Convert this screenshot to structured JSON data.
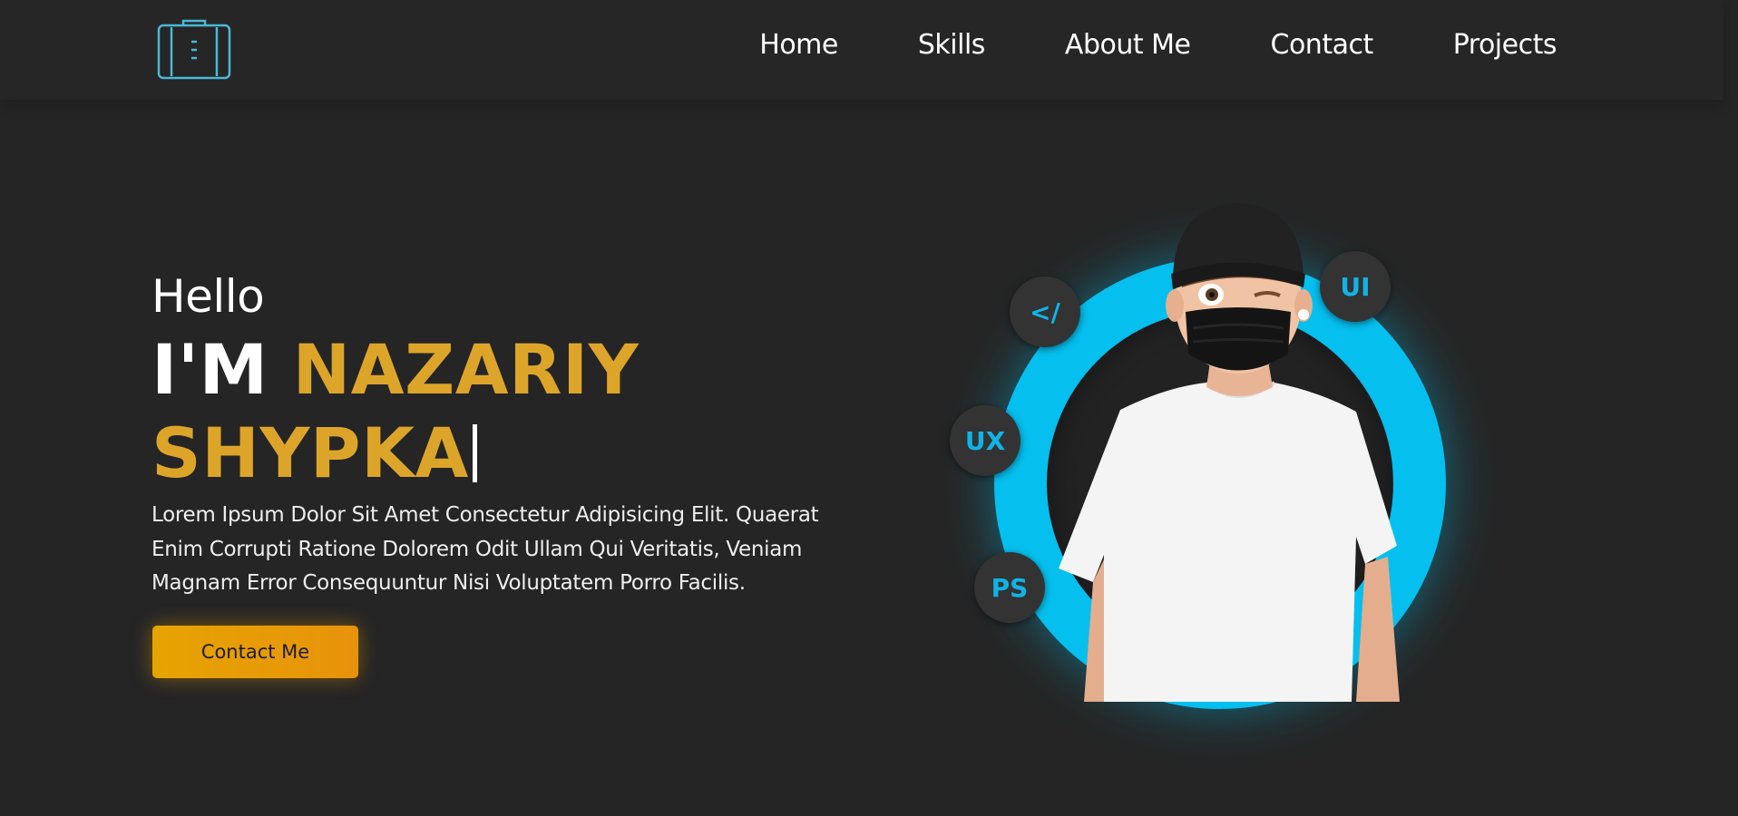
{
  "header": {
    "logo_icon": "briefcase-icon",
    "accent_color": "#4cb8d8",
    "nav": [
      {
        "label": "Home"
      },
      {
        "label": "Skills"
      },
      {
        "label": "About Me"
      },
      {
        "label": "Contact"
      },
      {
        "label": "Projects"
      }
    ]
  },
  "hero": {
    "greeting": "Hello",
    "intro": "I'M",
    "name_line1": "NAZARIY",
    "name_line2": "SHYPKA",
    "name_color": "#dca52a",
    "description": "Lorem Ipsum Dolor Sit Amet Consectetur Adipisicing Elit. Quaerat Enim Corrupti Ratione Dolorem Odit Ullam Qui Veritatis, Veniam Magnam Error Consequuntur Nisi Voluptatem Porro Facilis.",
    "cta_label": "Contact Me",
    "cta_color": "#e6a400"
  },
  "art": {
    "ring_color": "#05bfee",
    "badges": {
      "code": "</",
      "ui": "UI",
      "ux": "UX",
      "ps": "PS"
    },
    "person_image": "avatar-person-in-beanie-and-mask"
  }
}
